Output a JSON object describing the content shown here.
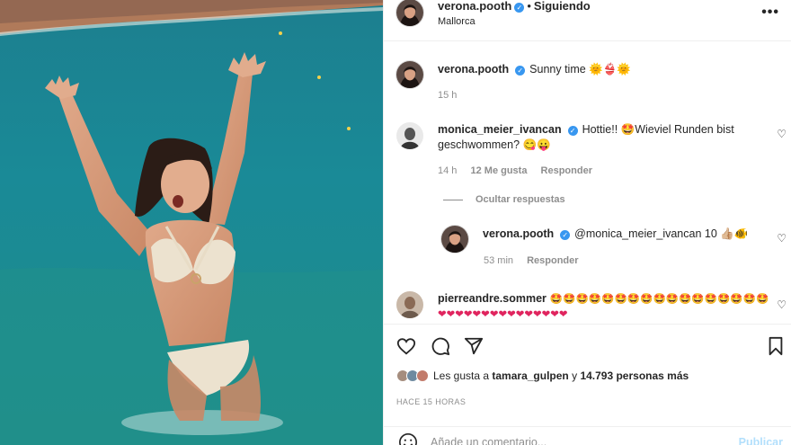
{
  "post": {
    "author": "verona.pooth",
    "follow_status": "Siguiendo",
    "separator": "•",
    "location": "Mallorca",
    "more_icon": "more-horizontal-icon"
  },
  "caption": {
    "author": "verona.pooth",
    "text": "Sunny time 🌞👙🌞",
    "time": "15 h"
  },
  "comments": [
    {
      "author": "monica_meier_ivancan",
      "text": "Hottie!! 🤩Wieviel Runden bist geschwommen? 😋😛",
      "time": "14 h",
      "likes": "12 Me gusta",
      "reply": "Responder"
    },
    {
      "author": "verona.pooth",
      "text": "@monica_meier_ivancan 10 👍🏼🐠",
      "time": "53 min",
      "reply": "Responder"
    },
    {
      "author": "pierreandre.sommer",
      "text": "🤩🤩🤩🤩🤩🤩🤩🤩🤩🤩🤩🤩🤩🤩🤩🤩🤩❤❤❤❤❤❤❤❤❤❤❤❤❤❤❤"
    }
  ],
  "hide_replies": "Ocultar respuestas",
  "likes": {
    "prefix": "Les gusta a",
    "user": "tamara_gulpen",
    "middle": "y",
    "count": "14.793 personas más"
  },
  "time_ago": "HACE 15 HORAS",
  "add_comment": {
    "placeholder": "Añade un comentario...",
    "post_label": "Publicar"
  },
  "colors": {
    "verified": "#3897f0",
    "secondary_text": "#8e8e8e",
    "publish_disabled": "#b2dffc"
  }
}
